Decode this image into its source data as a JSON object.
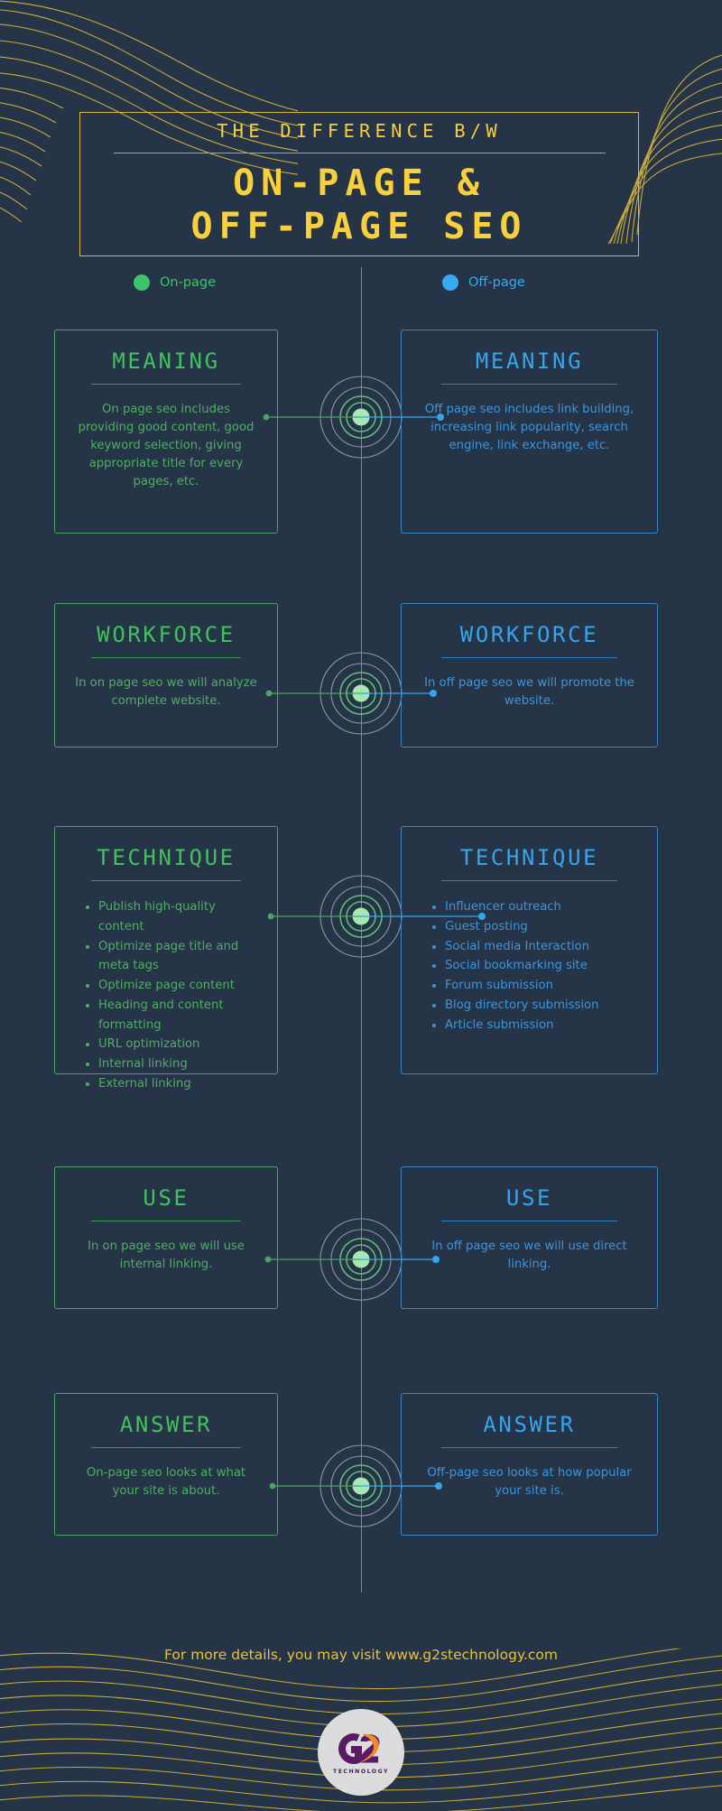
{
  "theme": {
    "background": "#253447",
    "accent_yellow": "#f5cf3f",
    "green": "#41c25c",
    "blue": "#35a6ee",
    "spine_gray": "#7d8794",
    "node_core": "#a5e8b4"
  },
  "header": {
    "kicker": "THE DIFFERENCE B/W",
    "title_line1": "ON-PAGE &",
    "title_line2": "OFF-PAGE SEO"
  },
  "legend": {
    "items": [
      {
        "label": "On-page",
        "color": "#3ec46a"
      },
      {
        "label": "Off-page",
        "color": "#36aaf2"
      }
    ]
  },
  "rows": [
    {
      "key": "meaning",
      "left": {
        "title": "MEANING",
        "body": "On page seo includes providing good content, good keyword selection, giving appropriate title for every pages, etc."
      },
      "right": {
        "title": "MEANING",
        "body": "Off page seo includes link building, increasing link popularity, search engine, link exchange, etc."
      }
    },
    {
      "key": "workforce",
      "left": {
        "title": "WORKFORCE",
        "body": "In on page seo we will analyze complete website."
      },
      "right": {
        "title": "WORKFORCE",
        "body": "In off page seo we will promote the website."
      }
    },
    {
      "key": "technique",
      "left": {
        "title": "TECHNIQUE",
        "items": [
          "Publish high-quality content",
          "Optimize page title and meta tags",
          "Optimize page content",
          "Heading and content formatting",
          "URL optimization",
          "Internal linking",
          "External linking"
        ]
      },
      "right": {
        "title": "TECHNIQUE",
        "items": [
          "Influencer outreach",
          "Guest posting",
          "Social media Interaction",
          "Social bookmarking site",
          "Forum submission",
          "Blog directory submission",
          "Article submission"
        ]
      }
    },
    {
      "key": "use",
      "left": {
        "title": "USE",
        "body": "In on page seo we will use internal linking."
      },
      "right": {
        "title": "USE",
        "body": "In off page seo we will use direct linking."
      }
    },
    {
      "key": "answer",
      "left": {
        "title": "ANSWER",
        "body": "On-page seo looks at what your site is about."
      },
      "right": {
        "title": "ANSWER",
        "body": "Off-page seo looks at how popular your site is."
      }
    }
  ],
  "footer": {
    "text": "For more details, you may visit www.g2stechnology.com",
    "logo_g": "G",
    "logo_2": "2",
    "logo_word": "TECHNOLOGY"
  }
}
